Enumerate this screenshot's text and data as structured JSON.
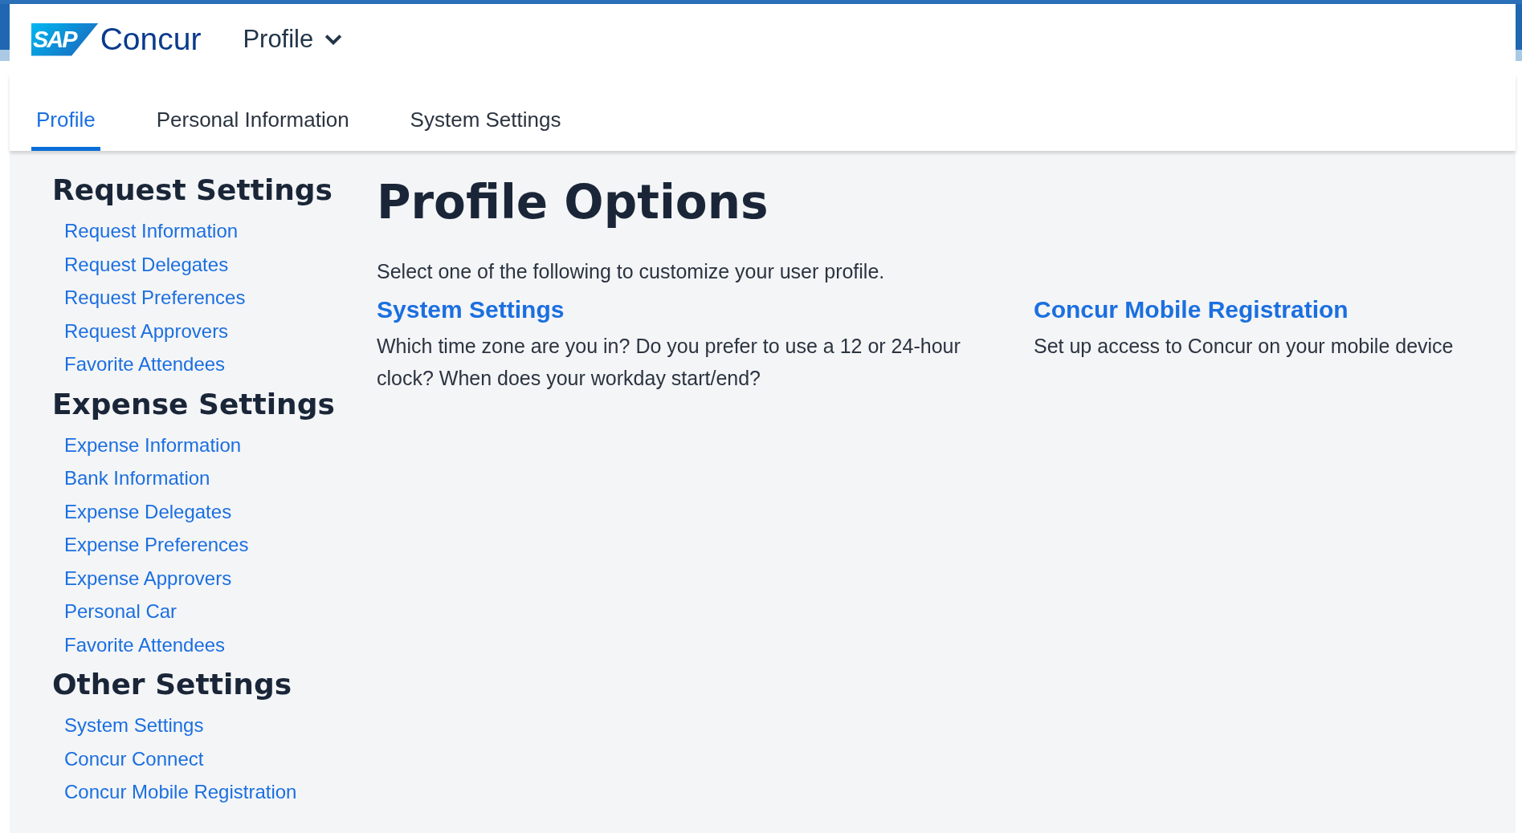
{
  "header": {
    "logo_mark": "SAP",
    "brand": "Concur",
    "menu": {
      "label": "Profile",
      "expanded": false
    }
  },
  "tabs": [
    {
      "label": "Profile",
      "selected": true
    },
    {
      "label": "Personal Information",
      "selected": false
    },
    {
      "label": "System Settings",
      "selected": false
    }
  ],
  "sidebar": {
    "sections": [
      {
        "title": "Request Settings",
        "items": [
          "Request Information",
          "Request Delegates",
          "Request Preferences",
          "Request Approvers",
          "Favorite Attendees"
        ]
      },
      {
        "title": "Expense Settings",
        "items": [
          "Expense Information",
          "Bank Information",
          "Expense Delegates",
          "Expense Preferences",
          "Expense Approvers",
          "Personal Car",
          "Favorite Attendees"
        ]
      },
      {
        "title": "Other Settings",
        "items": [
          "System Settings",
          "Concur Connect",
          "Concur Mobile Registration"
        ]
      }
    ]
  },
  "main": {
    "title": "Profile Options",
    "intro": "Select one of the following to customize your user profile.",
    "options": [
      {
        "title": "System Settings",
        "description": "Which time zone are you in? Do you prefer to use a 12 or 24-hour clock? When does your workday start/end?"
      },
      {
        "title": "Concur Mobile Registration",
        "description": "Set up access to Concur on your mobile device"
      }
    ]
  }
}
